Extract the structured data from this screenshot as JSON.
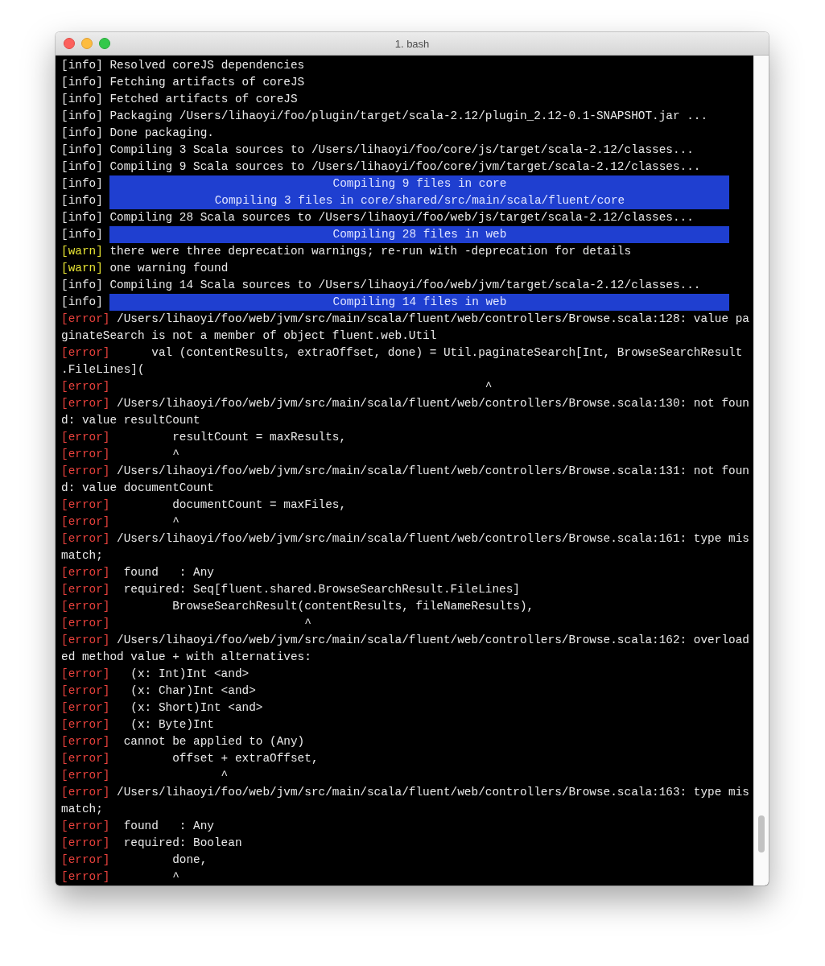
{
  "window": {
    "title": "1. bash"
  },
  "lines": [
    {
      "kind": "info",
      "tag": "[info]",
      "text": "Resolved coreJS dependencies"
    },
    {
      "kind": "info",
      "tag": "[info]",
      "text": "Fetching artifacts of coreJS"
    },
    {
      "kind": "info",
      "tag": "[info]",
      "text": "Fetched artifacts of coreJS"
    },
    {
      "kind": "info",
      "tag": "[info]",
      "text": "Packaging /Users/lihaoyi/foo/plugin/target/scala-2.12/plugin_2.12-0.1-SNAPSHOT.jar ..."
    },
    {
      "kind": "info",
      "tag": "[info]",
      "text": "Done packaging."
    },
    {
      "kind": "info",
      "tag": "[info]",
      "text": "Compiling 3 Scala sources to /Users/lihaoyi/foo/core/js/target/scala-2.12/classes..."
    },
    {
      "kind": "info",
      "tag": "[info]",
      "text": "Compiling 9 Scala sources to /Users/lihaoyi/foo/core/jvm/target/scala-2.12/classes..."
    },
    {
      "kind": "banner",
      "tag": "[info]",
      "text": "Compiling 9 files in core"
    },
    {
      "kind": "banner",
      "tag": "[info]",
      "text": "Compiling 3 files in core/shared/src/main/scala/fluent/core"
    },
    {
      "kind": "info",
      "tag": "[info]",
      "text": "Compiling 28 Scala sources to /Users/lihaoyi/foo/web/js/target/scala-2.12/classes..."
    },
    {
      "kind": "banner",
      "tag": "[info]",
      "text": "Compiling 28 files in web"
    },
    {
      "kind": "warn",
      "tag": "[warn]",
      "text": "there were three deprecation warnings; re-run with -deprecation for details"
    },
    {
      "kind": "warn",
      "tag": "[warn]",
      "text": "one warning found"
    },
    {
      "kind": "info",
      "tag": "[info]",
      "text": "Compiling 14 Scala sources to /Users/lihaoyi/foo/web/jvm/target/scala-2.12/classes..."
    },
    {
      "kind": "banner",
      "tag": "[info]",
      "text": "Compiling 14 files in web"
    },
    {
      "kind": "error",
      "tag": "[error]",
      "text": "/Users/lihaoyi/foo/web/jvm/src/main/scala/fluent/web/controllers/Browse.scala:128: value pa"
    },
    {
      "kind": "wrap",
      "text": "ginateSearch is not a member of object fluent.web.Util"
    },
    {
      "kind": "error",
      "tag": "[error]",
      "text": "     val (contentResults, extraOffset, done) = Util.paginateSearch[Int, BrowseSearchResult"
    },
    {
      "kind": "wrap",
      "text": ".FileLines]("
    },
    {
      "kind": "error",
      "tag": "[error]",
      "text": "                                                     ^"
    },
    {
      "kind": "error",
      "tag": "[error]",
      "text": "/Users/lihaoyi/foo/web/jvm/src/main/scala/fluent/web/controllers/Browse.scala:130: not foun"
    },
    {
      "kind": "wrap",
      "text": "d: value resultCount"
    },
    {
      "kind": "error",
      "tag": "[error]",
      "text": "        resultCount = maxResults,"
    },
    {
      "kind": "error",
      "tag": "[error]",
      "text": "        ^"
    },
    {
      "kind": "error",
      "tag": "[error]",
      "text": "/Users/lihaoyi/foo/web/jvm/src/main/scala/fluent/web/controllers/Browse.scala:131: not foun"
    },
    {
      "kind": "wrap",
      "text": "d: value documentCount"
    },
    {
      "kind": "error",
      "tag": "[error]",
      "text": "        documentCount = maxFiles,"
    },
    {
      "kind": "error",
      "tag": "[error]",
      "text": "        ^"
    },
    {
      "kind": "error",
      "tag": "[error]",
      "text": "/Users/lihaoyi/foo/web/jvm/src/main/scala/fluent/web/controllers/Browse.scala:161: type mis"
    },
    {
      "kind": "wrap",
      "text": "match;"
    },
    {
      "kind": "error",
      "tag": "[error]",
      "text": " found   : Any"
    },
    {
      "kind": "error",
      "tag": "[error]",
      "text": " required: Seq[fluent.shared.BrowseSearchResult.FileLines]"
    },
    {
      "kind": "error",
      "tag": "[error]",
      "text": "        BrowseSearchResult(contentResults, fileNameResults),"
    },
    {
      "kind": "error",
      "tag": "[error]",
      "text": "                           ^"
    },
    {
      "kind": "error",
      "tag": "[error]",
      "text": "/Users/lihaoyi/foo/web/jvm/src/main/scala/fluent/web/controllers/Browse.scala:162: overload"
    },
    {
      "kind": "wrap",
      "text": "ed method value + with alternatives:"
    },
    {
      "kind": "error",
      "tag": "[error]",
      "text": "  (x: Int)Int <and>"
    },
    {
      "kind": "error",
      "tag": "[error]",
      "text": "  (x: Char)Int <and>"
    },
    {
      "kind": "error",
      "tag": "[error]",
      "text": "  (x: Short)Int <and>"
    },
    {
      "kind": "error",
      "tag": "[error]",
      "text": "  (x: Byte)Int"
    },
    {
      "kind": "error",
      "tag": "[error]",
      "text": " cannot be applied to (Any)"
    },
    {
      "kind": "error",
      "tag": "[error]",
      "text": "        offset + extraOffset,"
    },
    {
      "kind": "error",
      "tag": "[error]",
      "text": "               ^"
    },
    {
      "kind": "error",
      "tag": "[error]",
      "text": "/Users/lihaoyi/foo/web/jvm/src/main/scala/fluent/web/controllers/Browse.scala:163: type mis"
    },
    {
      "kind": "wrap",
      "text": "match;"
    },
    {
      "kind": "error",
      "tag": "[error]",
      "text": " found   : Any"
    },
    {
      "kind": "error",
      "tag": "[error]",
      "text": " required: Boolean"
    },
    {
      "kind": "error",
      "tag": "[error]",
      "text": "        done,"
    },
    {
      "kind": "error",
      "tag": "[error]",
      "text": "        ^"
    }
  ]
}
